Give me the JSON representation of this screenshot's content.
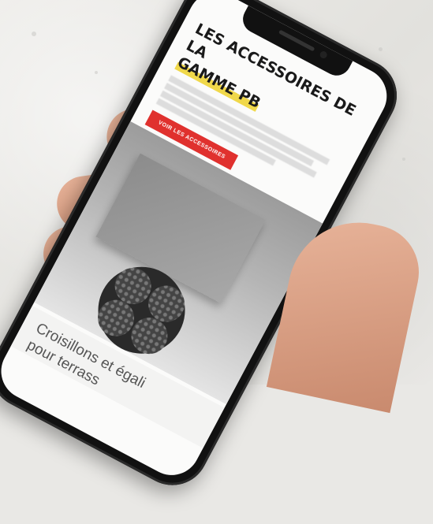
{
  "scene": {
    "description_colors": {
      "wall": "#e9e8e5",
      "phone": "#111111",
      "accent": "#e0312e",
      "highlight": "#f0d84a"
    }
  },
  "phone_screen": {
    "heading_line1": "LES ACCESSOIRES DE LA",
    "heading_line2": "GAMME PB",
    "cta_label": "VOIR LES ACCESSOIRES",
    "card_title_line1": "Croisillons et égali",
    "card_title_line2": "pour terrass"
  }
}
